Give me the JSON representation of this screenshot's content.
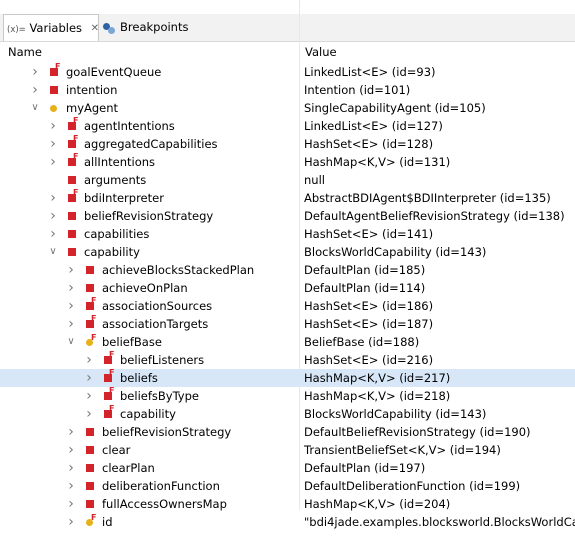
{
  "tabs": [
    {
      "label": "Variables",
      "icon_text": "(x)="
    },
    {
      "label": "Breakpoints"
    }
  ],
  "columns": {
    "name": "Name",
    "value": "Value"
  },
  "rows": [
    {
      "name": "goalEventQueue",
      "value": "LinkedList<E>  (id=93)",
      "depth": 0,
      "toggle": "collapsed",
      "icon": "field-final"
    },
    {
      "name": "intention",
      "value": "Intention  (id=101)",
      "depth": 0,
      "toggle": "collapsed",
      "icon": "field"
    },
    {
      "name": "myAgent",
      "value": "SingleCapabilityAgent  (id=105)",
      "depth": 0,
      "toggle": "expanded",
      "icon": "local"
    },
    {
      "name": "agentIntentions",
      "value": "LinkedList<E>  (id=127)",
      "depth": 1,
      "toggle": "collapsed",
      "icon": "field-final"
    },
    {
      "name": "aggregatedCapabilities",
      "value": "HashSet<E>  (id=128)",
      "depth": 1,
      "toggle": "collapsed",
      "icon": "field-final"
    },
    {
      "name": "allIntentions",
      "value": "HashMap<K,V>  (id=131)",
      "depth": 1,
      "toggle": "collapsed",
      "icon": "field-final"
    },
    {
      "name": "arguments",
      "value": "null",
      "depth": 1,
      "toggle": "none",
      "icon": "field"
    },
    {
      "name": "bdiInterpreter",
      "value": "AbstractBDIAgent$BDIInterpreter  (id=135)",
      "depth": 1,
      "toggle": "collapsed",
      "icon": "field-final"
    },
    {
      "name": "beliefRevisionStrategy",
      "value": "DefaultAgentBeliefRevisionStrategy  (id=138)",
      "depth": 1,
      "toggle": "collapsed",
      "icon": "field"
    },
    {
      "name": "capabilities",
      "value": "HashSet<E>  (id=141)",
      "depth": 1,
      "toggle": "collapsed",
      "icon": "field"
    },
    {
      "name": "capability",
      "value": "BlocksWorldCapability  (id=143)",
      "depth": 1,
      "toggle": "expanded",
      "icon": "field"
    },
    {
      "name": "achieveBlocksStackedPlan",
      "value": "DefaultPlan  (id=185)",
      "depth": 2,
      "toggle": "collapsed",
      "icon": "field"
    },
    {
      "name": "achieveOnPlan",
      "value": "DefaultPlan  (id=114)",
      "depth": 2,
      "toggle": "collapsed",
      "icon": "field"
    },
    {
      "name": "associationSources",
      "value": "HashSet<E>  (id=186)",
      "depth": 2,
      "toggle": "collapsed",
      "icon": "field-final"
    },
    {
      "name": "associationTargets",
      "value": "HashSet<E>  (id=187)",
      "depth": 2,
      "toggle": "collapsed",
      "icon": "field-final"
    },
    {
      "name": "beliefBase",
      "value": "BeliefBase  (id=188)",
      "depth": 2,
      "toggle": "expanded",
      "icon": "local-final"
    },
    {
      "name": "beliefListeners",
      "value": "HashSet<E>  (id=216)",
      "depth": 3,
      "toggle": "collapsed",
      "icon": "field-final"
    },
    {
      "name": "beliefs",
      "value": "HashMap<K,V>  (id=217)",
      "depth": 3,
      "toggle": "collapsed",
      "icon": "field-final",
      "selected": true
    },
    {
      "name": "beliefsByType",
      "value": "HashMap<K,V>  (id=218)",
      "depth": 3,
      "toggle": "collapsed",
      "icon": "field-final"
    },
    {
      "name": "capability",
      "value": "BlocksWorldCapability  (id=143)",
      "depth": 3,
      "toggle": "collapsed",
      "icon": "field-final"
    },
    {
      "name": "beliefRevisionStrategy",
      "value": "DefaultBeliefRevisionStrategy  (id=190)",
      "depth": 2,
      "toggle": "collapsed",
      "icon": "field"
    },
    {
      "name": "clear",
      "value": "TransientBeliefSet<K,V>  (id=194)",
      "depth": 2,
      "toggle": "collapsed",
      "icon": "field"
    },
    {
      "name": "clearPlan",
      "value": "DefaultPlan  (id=197)",
      "depth": 2,
      "toggle": "collapsed",
      "icon": "field"
    },
    {
      "name": "deliberationFunction",
      "value": "DefaultDeliberationFunction  (id=199)",
      "depth": 2,
      "toggle": "collapsed",
      "icon": "field"
    },
    {
      "name": "fullAccessOwnersMap",
      "value": "HashMap<K,V>  (id=204)",
      "depth": 2,
      "toggle": "collapsed",
      "icon": "field"
    },
    {
      "name": "id",
      "value": "\"bdi4jade.examples.blocksworld.BlocksWorldCa...",
      "depth": 2,
      "toggle": "collapsed",
      "icon": "local-final"
    }
  ],
  "colors": {
    "selection": "#d7e7f7",
    "field_icon": "#d3242c",
    "local_icon": "#e8b11a"
  }
}
